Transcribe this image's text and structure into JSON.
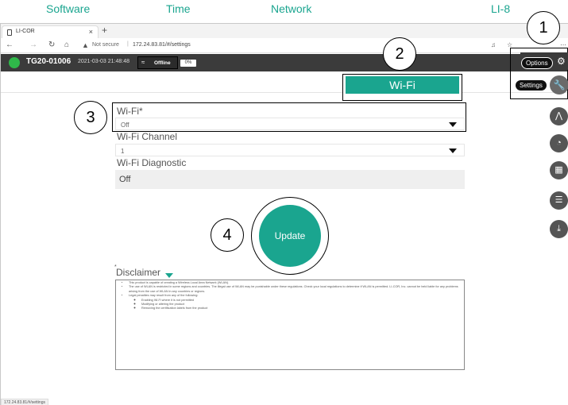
{
  "browser": {
    "tab_title": "LI-COR",
    "tab_close": "×",
    "new_tab": "+",
    "secure_label": "Not secure",
    "url": "172.24.83.81/#/settings",
    "status_url": "172.24.83.81/#/settings"
  },
  "status_bar": {
    "device_name": "TG20-01006",
    "datetime": "2021-03-03 21:48:48",
    "connection": "Offline",
    "battery": "0%",
    "status_color": "#2fb84a"
  },
  "tabs": [
    {
      "label": "Software"
    },
    {
      "label": "Time"
    },
    {
      "label": "Network"
    },
    {
      "label": "Wi-Fi",
      "active": true
    },
    {
      "label": "LI-8"
    }
  ],
  "form": {
    "wifi_label": "Wi-Fi*",
    "wifi_value": "Off",
    "channel_label": "Wi-Fi Channel",
    "channel_value": "1",
    "diagnostic_label": "Wi-Fi Diagnostic",
    "diagnostic_value": "Off",
    "update_label": "Update"
  },
  "disclaimer": {
    "star": "*",
    "title": "Disclaimer",
    "items": [
      "This product is capable of creating a Wireless Local Area Network (WLAN).",
      "The use of WLAN is restricted in some regions and countries. The illegal use of WLAN may be punishable under these regulations. Check your local regulations to determine if WLAN is permitted. LI-COR, Inc. cannot be held liable for any problems arising from the use of WLAN in any countries or regions.",
      "Legal penalties may result from any of the following:"
    ],
    "subitems": [
      "Enabling Wi-Fi where it is not permitted",
      "Modifying or altering the product",
      "Removing the certification labels from the product"
    ]
  },
  "rail": {
    "options_label": "Options",
    "settings_label": "Settings"
  },
  "callouts": [
    "1",
    "2",
    "3",
    "4"
  ],
  "colors": {
    "accent": "#1aa58f",
    "status_bar": "#3b3b3b"
  }
}
